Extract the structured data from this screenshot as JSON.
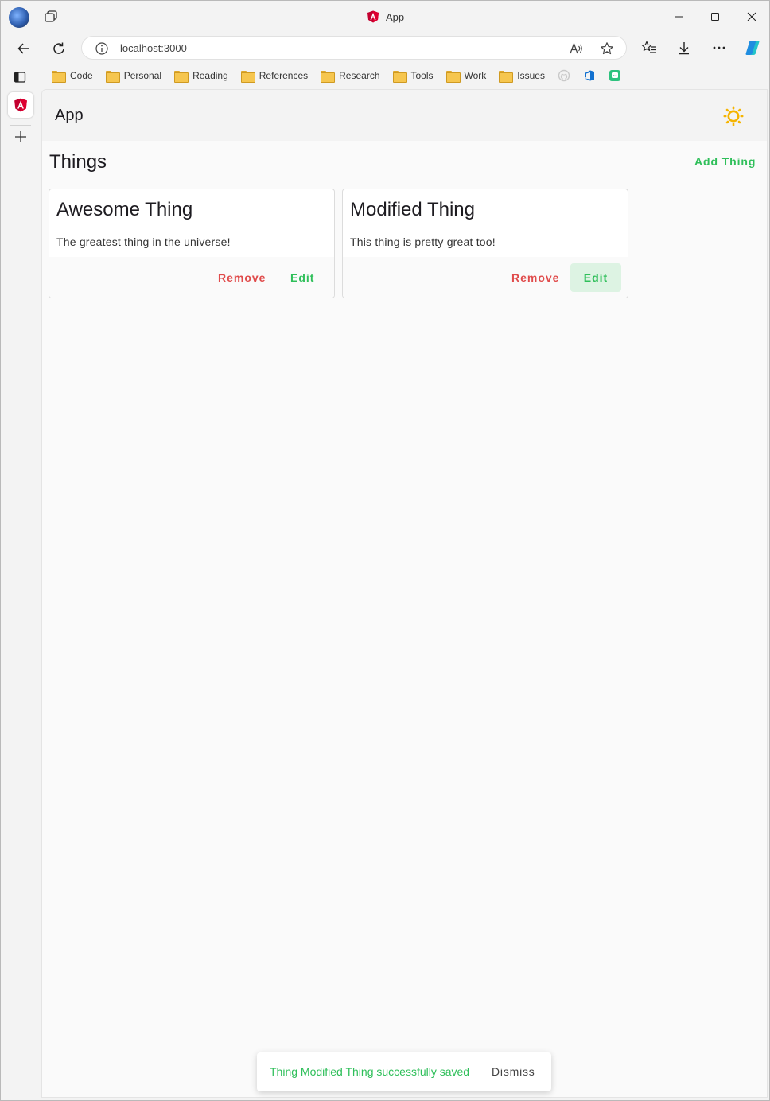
{
  "browser": {
    "tab_title": "App",
    "url": "localhost:3000",
    "icons": [
      "profile-avatar",
      "tab-actions-icon",
      "angular-logo",
      "minimize-icon",
      "maximize-icon",
      "close-icon",
      "back-icon",
      "refresh-icon",
      "site-info-icon",
      "read-aloud-icon",
      "favorite-star-icon",
      "favorites-icon",
      "download-icon",
      "more-icon",
      "copilot-icon",
      "vertical-tabs-icon",
      "new-tab-icon"
    ],
    "bookmarks": [
      {
        "label": "Code"
      },
      {
        "label": "Personal"
      },
      {
        "label": "Reading"
      },
      {
        "label": "References"
      },
      {
        "label": "Research"
      },
      {
        "label": "Tools"
      },
      {
        "label": "Work"
      },
      {
        "label": "Issues"
      }
    ],
    "bookmark_icons": [
      "github-icon",
      "azure-devops-icon",
      "green-app-icon"
    ]
  },
  "app": {
    "title": "App",
    "theme_icon": "sun-icon",
    "heading": "Things",
    "add_label": "Add Thing",
    "things": [
      {
        "title": "Awesome Thing",
        "description": "The greatest thing in the universe!",
        "remove_label": "Remove",
        "edit_label": "Edit"
      },
      {
        "title": "Modified Thing",
        "description": "This thing is pretty great too!",
        "remove_label": "Remove",
        "edit_label": "Edit"
      }
    ]
  },
  "snackbar": {
    "message": "Thing Modified Thing successfully saved",
    "action": "Dismiss"
  },
  "colors": {
    "accent_green": "#2fbf5a",
    "warn_red": "#e04b4b",
    "sun_yellow": "#f5b400",
    "angular_magenta": "#dd0031"
  }
}
